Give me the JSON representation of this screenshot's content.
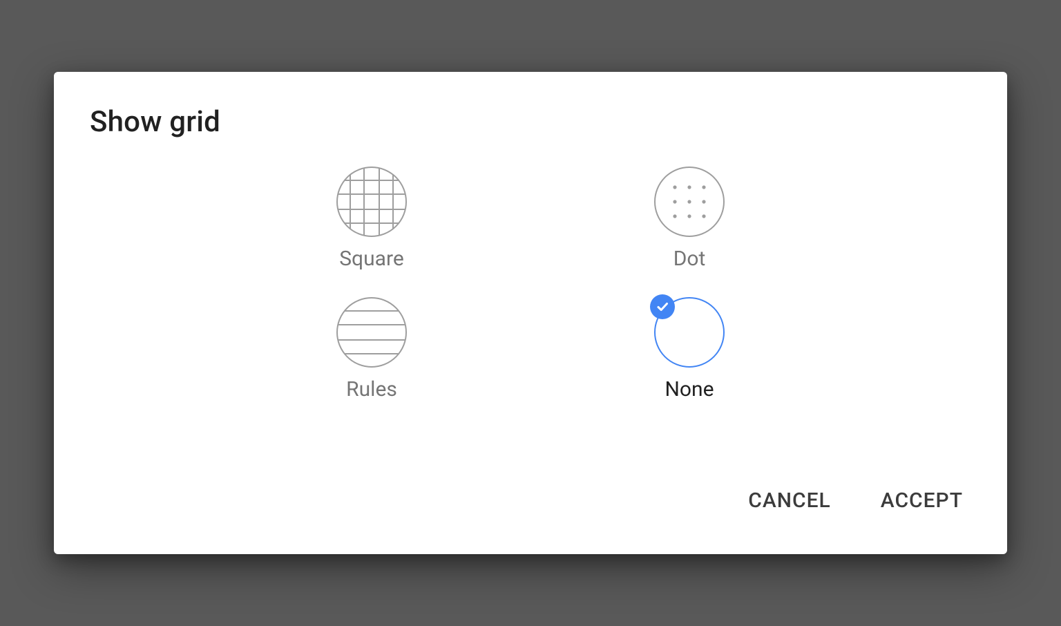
{
  "dialog": {
    "title": "Show grid",
    "options": [
      {
        "label": "Square"
      },
      {
        "label": "Dot"
      },
      {
        "label": "Rules"
      },
      {
        "label": "None"
      }
    ],
    "selected_index": 3,
    "actions": {
      "cancel": "CANCEL",
      "accept": "ACCEPT"
    }
  },
  "colors": {
    "accent": "#4285f4",
    "icon_stroke": "#9e9e9e",
    "text_muted": "#757575"
  }
}
